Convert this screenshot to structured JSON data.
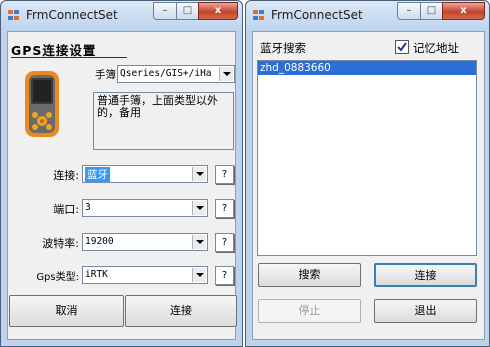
{
  "left": {
    "title": "FrmConnectSet",
    "section_title": "GPS连接设置",
    "handbook_label": "手簿:",
    "handbook_value": "Qseries/GIS+/iHa",
    "description": "普通手簿，上面类型以外的，备用",
    "connect_label": "连接:",
    "connect_value": "蓝牙",
    "port_label": "端口:",
    "port_value": "3",
    "baud_label": "波特率:",
    "baud_value": "19200",
    "gps_type_label": "Gps类型:",
    "gps_type_value": "iRTK",
    "help_label": "?",
    "cancel_label": "取消",
    "connect_button_label": "连接"
  },
  "right": {
    "title": "FrmConnectSet",
    "bt_search_label": "蓝牙搜索",
    "remember_label": "记忆地址",
    "remember_checked": true,
    "devices": [
      "zhd_0883660"
    ],
    "search_label": "搜索",
    "connect_label": "连接",
    "stop_label": "停止",
    "exit_label": "退出"
  },
  "window_controls": {
    "minimize": "–",
    "maximize": "□",
    "close": "x"
  },
  "colors": {
    "selection": "#3399ff",
    "selected_row": "#2b6fd6",
    "frame": "#bfd4ec"
  }
}
